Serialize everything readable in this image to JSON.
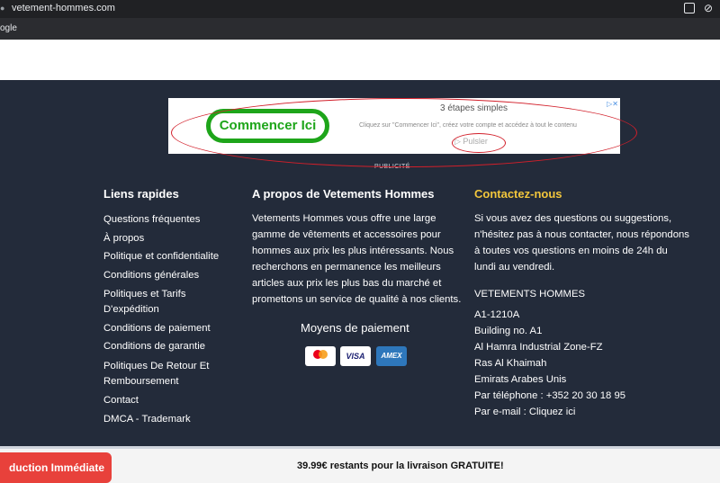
{
  "browser": {
    "url": "vetement-hommes.com",
    "bookmark": "ogle"
  },
  "ad": {
    "button_label": "Commencer Ici",
    "title": "3 étapes simples",
    "description": "Cliquez sur \"Commencer Ici\", créez votre compte et accédez à tout le contenu",
    "pulse_label": "Pulsler",
    "publicite": "PUBLICITÉ"
  },
  "quick_links": {
    "title": "Liens rapides",
    "items": [
      "Questions fréquentes",
      "À propos",
      "Politique et confidentialite",
      "Conditions générales",
      "Politiques et Tarifs",
      "D'expédition",
      "Conditions de paiement",
      "Conditions de garantie",
      "Politiques De Retour Et",
      "Remboursement",
      "Contact",
      "DMCA - Trademark"
    ]
  },
  "about": {
    "title": "A propos de Vetements Hommes",
    "lines": [
      "Vetements Hommes vous offre une large",
      "gamme de vêtements et accessoires pour",
      "hommes aux prix les plus intéressants. Nous",
      "recherchons en permanence les meilleurs",
      "articles aux prix les plus bas du marché et",
      "promettons un service de qualité à nos clients."
    ],
    "payment_title": "Moyens de paiement",
    "cards": [
      "MasterCard",
      "VISA",
      "AMEX"
    ]
  },
  "contact": {
    "title": "Contactez-nous",
    "intro": [
      "Si vous avez des questions ou suggestions,",
      "n'hésitez pas à nous contacter, nous répondons",
      "à toutes vos questions en moins de 24h du",
      "lundi au vendredi."
    ],
    "company": "VETEMENTS HOMMES",
    "address": [
      "A1-1210A",
      "Building no. A1",
      "Al Hamra Industrial Zone-FZ",
      "Ras Al Khaimah",
      "Emirats Arabes Unis",
      "Par téléphone : +352 20 30 18 95",
      "Par e-mail : Cliquez ici"
    ]
  },
  "bottom": {
    "shipping": "39.99€ restants pour la livraison GRATUITE!",
    "button": "duction Immédiate"
  }
}
